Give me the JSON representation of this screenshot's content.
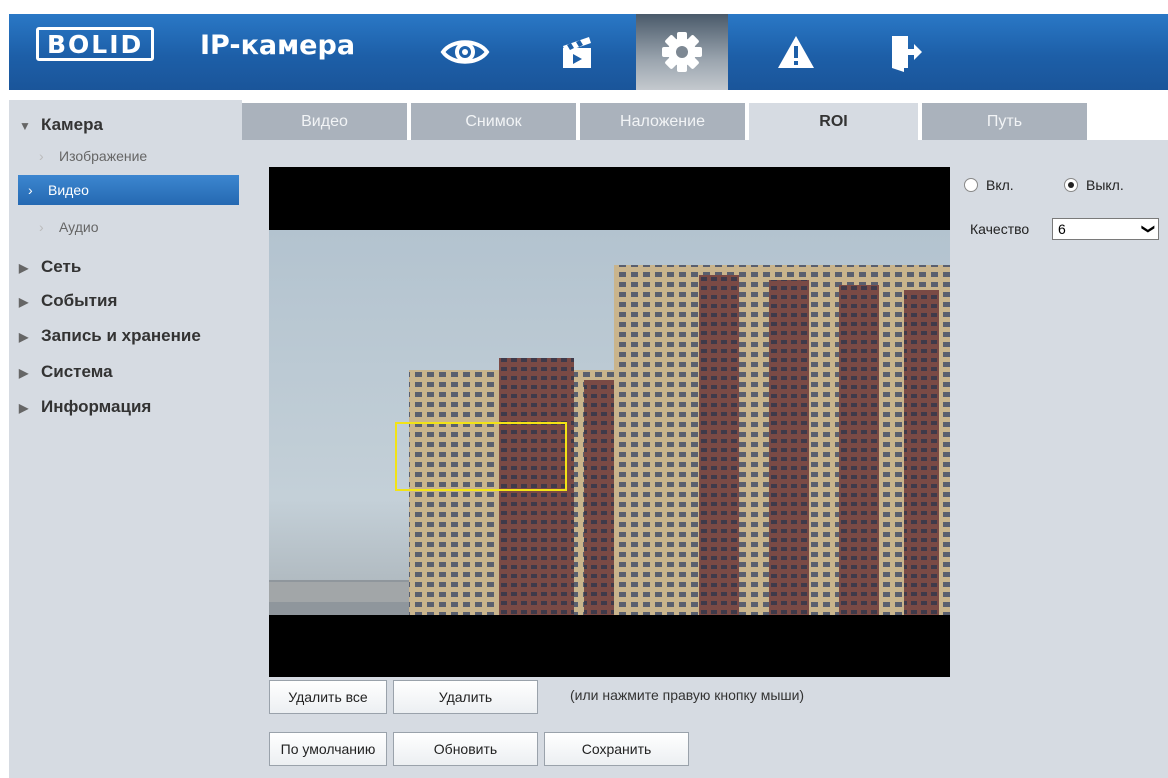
{
  "header": {
    "logo_text": "BOLID",
    "title": "IP-камера",
    "nav_icons": [
      "eye-icon",
      "clapperboard-icon",
      "gear-icon",
      "warning-icon",
      "exit-icon"
    ],
    "active_nav": "gear-icon",
    "bar_color": "#1d5fa8"
  },
  "sidebar": {
    "camera": "Камера",
    "camera_sub": [
      "Изображение",
      "Видео",
      "Аудио"
    ],
    "active_sub": "Видео",
    "sections": [
      "Сеть",
      "События",
      "Запись и хранение",
      "Система",
      "Информация"
    ]
  },
  "tabs": [
    "Видео",
    "Снимок",
    "Наложение",
    "ROI",
    "Путь"
  ],
  "active_tab": "ROI",
  "roi": {
    "on_label": "Вкл.",
    "off_label": "Выкл.",
    "selected": "off",
    "quality_label": "Качество",
    "quality_value": "6",
    "roi_box_color": "#f2e316"
  },
  "buttons": {
    "delete_all": "Удалить все",
    "delete": "Удалить",
    "hint": "(или нажмите правую кнопку мыши)",
    "default": "По умолчанию",
    "refresh": "Обновить",
    "save": "Сохранить"
  }
}
